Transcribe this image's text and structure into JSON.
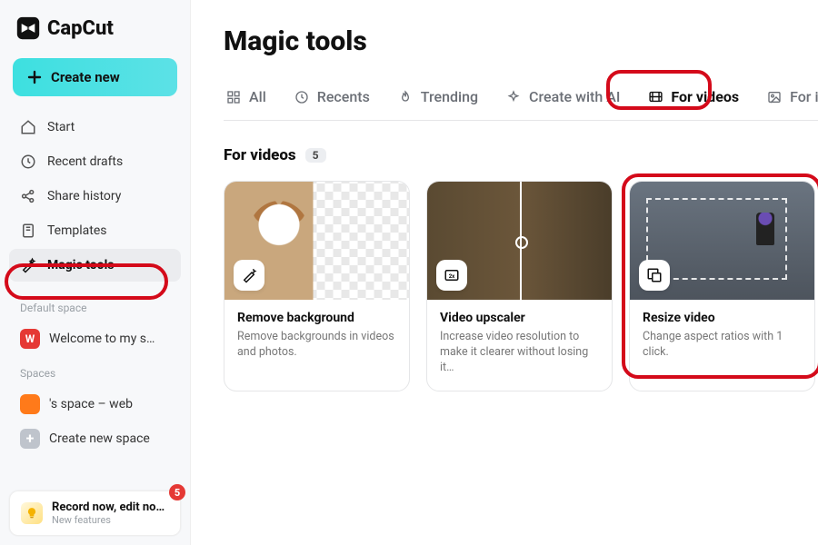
{
  "app": {
    "name": "CapCut"
  },
  "sidebar": {
    "create_label": "Create new",
    "items": [
      {
        "label": "Start"
      },
      {
        "label": "Recent drafts"
      },
      {
        "label": "Share history"
      },
      {
        "label": "Templates"
      },
      {
        "label": "Magic tools"
      }
    ],
    "default_space_label": "Default space",
    "welcome_space": {
      "initial": "W",
      "label": "Welcome to my s…",
      "avatar_color": "#e53935"
    },
    "spaces_label": "Spaces",
    "user_space": {
      "label": "'s space – web",
      "avatar_color": "#ff7a1a"
    },
    "create_space_label": "Create new space"
  },
  "bottom": {
    "title": "Record now, edit no…",
    "subtitle": "New features",
    "badge": "5"
  },
  "page": {
    "title": "Magic tools",
    "tabs": [
      {
        "label": "All"
      },
      {
        "label": "Recents"
      },
      {
        "label": "Trending"
      },
      {
        "label": "Create with AI"
      },
      {
        "label": "For videos"
      },
      {
        "label": "For images"
      }
    ],
    "section": {
      "title": "For videos",
      "count": "5"
    },
    "cards": [
      {
        "title": "Remove background",
        "desc": "Remove backgrounds in videos and photos."
      },
      {
        "title": "Video upscaler",
        "desc": "Increase video resolution to make it clearer without losing it…"
      },
      {
        "title": "Resize video",
        "desc": "Change aspect ratios with 1 click."
      }
    ]
  }
}
